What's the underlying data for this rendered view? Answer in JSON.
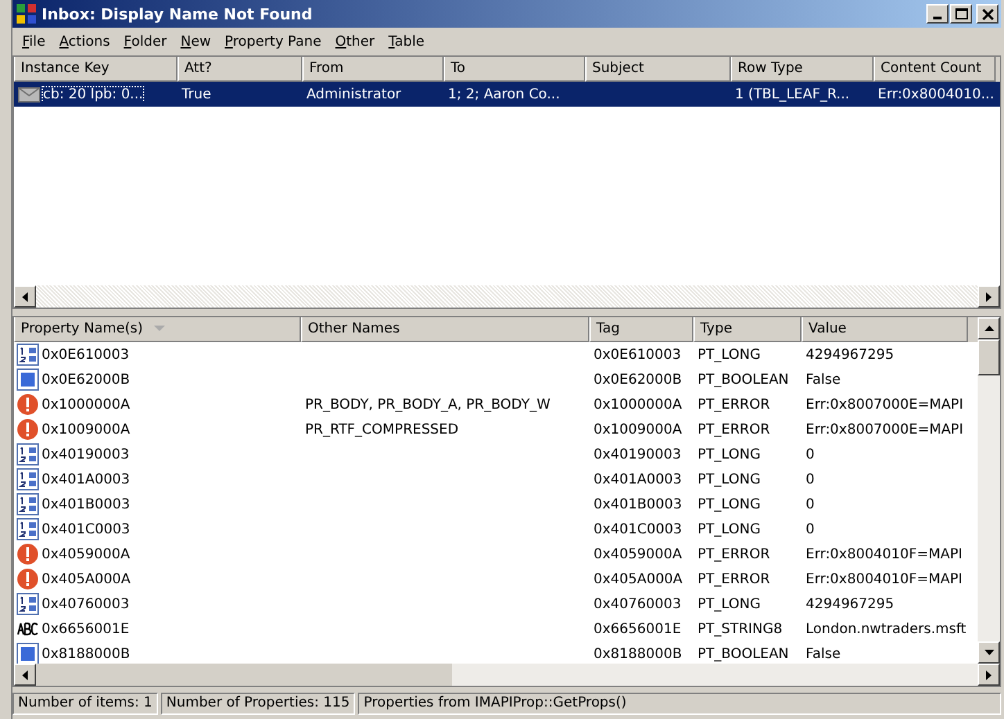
{
  "window": {
    "title": "Inbox: Display Name Not Found"
  },
  "menu": [
    "File",
    "Actions",
    "Folder",
    "New",
    "Property Pane",
    "Other",
    "Table"
  ],
  "messages": {
    "columns": [
      "Instance Key",
      "Att?",
      "From",
      "To",
      "Subject",
      "Row Type",
      "Content Count"
    ],
    "rows": [
      {
        "selected": true,
        "cells": [
          "cb: 20 lpb: 0...",
          "True",
          "Administrator",
          "1; 2; Aaron Co...",
          "",
          "1 (TBL_LEAF_R...",
          "Err:0x8004010..."
        ]
      }
    ]
  },
  "properties": {
    "columns": [
      "Property Name(s)",
      "Other Names",
      "Tag",
      "Type",
      "Value"
    ],
    "rows": [
      {
        "kind": "long",
        "cells": [
          "0x0E610003",
          "",
          "0x0E610003",
          "PT_LONG",
          "4294967295"
        ]
      },
      {
        "kind": "boolean",
        "cells": [
          "0x0E62000B",
          "",
          "0x0E62000B",
          "PT_BOOLEAN",
          "False"
        ]
      },
      {
        "kind": "error",
        "cells": [
          "0x1000000A",
          "PR_BODY, PR_BODY_A, PR_BODY_W",
          "0x1000000A",
          "PT_ERROR",
          "Err:0x8007000E=MAPI"
        ]
      },
      {
        "kind": "error",
        "cells": [
          "0x1009000A",
          "PR_RTF_COMPRESSED",
          "0x1009000A",
          "PT_ERROR",
          "Err:0x8007000E=MAPI"
        ]
      },
      {
        "kind": "long",
        "cells": [
          "0x40190003",
          "",
          "0x40190003",
          "PT_LONG",
          "0"
        ]
      },
      {
        "kind": "long",
        "cells": [
          "0x401A0003",
          "",
          "0x401A0003",
          "PT_LONG",
          "0"
        ]
      },
      {
        "kind": "long",
        "cells": [
          "0x401B0003",
          "",
          "0x401B0003",
          "PT_LONG",
          "0"
        ]
      },
      {
        "kind": "long",
        "cells": [
          "0x401C0003",
          "",
          "0x401C0003",
          "PT_LONG",
          "0"
        ]
      },
      {
        "kind": "error",
        "cells": [
          "0x4059000A",
          "",
          "0x4059000A",
          "PT_ERROR",
          "Err:0x8004010F=MAPI"
        ]
      },
      {
        "kind": "error",
        "cells": [
          "0x405A000A",
          "",
          "0x405A000A",
          "PT_ERROR",
          "Err:0x8004010F=MAPI"
        ]
      },
      {
        "kind": "long",
        "cells": [
          "0x40760003",
          "",
          "0x40760003",
          "PT_LONG",
          "4294967295"
        ]
      },
      {
        "kind": "string",
        "cells": [
          "0x6656001E",
          "",
          "0x6656001E",
          "PT_STRING8",
          "London.nwtraders.msft"
        ]
      },
      {
        "kind": "boolean",
        "cells": [
          "0x8188000B",
          "",
          "0x8188000B",
          "PT_BOOLEAN",
          "False"
        ]
      }
    ]
  },
  "status_bar": [
    "Number of items: 1",
    "Number of Properties: 115",
    "Properties from IMAPIProp::GetProps()"
  ]
}
